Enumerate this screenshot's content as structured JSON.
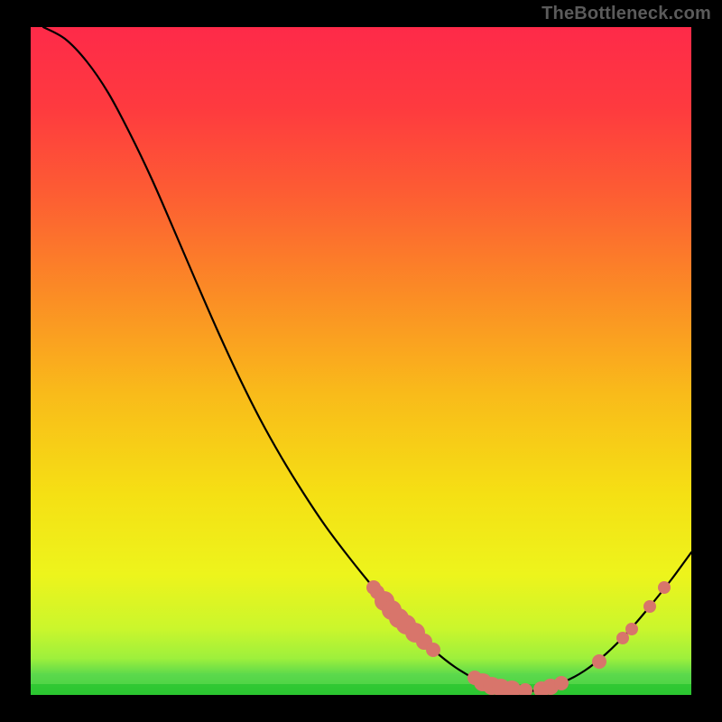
{
  "watermark": "TheBottleneck.com",
  "chart_data": {
    "type": "line",
    "title": "",
    "xlabel": "",
    "ylabel": "",
    "xlim": [
      34,
      766
    ],
    "ylim": [
      770,
      30
    ],
    "grid": false,
    "legend": false,
    "curve": {
      "name": "bottleneck-curve",
      "x": [
        48,
        72,
        96,
        120,
        144,
        168,
        192,
        216,
        240,
        264,
        288,
        312,
        336,
        360,
        384,
        408,
        432,
        456,
        480,
        504,
        528,
        552,
        576,
        600,
        624,
        648,
        672,
        696,
        720,
        744,
        766
      ],
      "y": [
        30,
        43,
        68,
        103,
        148,
        198,
        253,
        309,
        364,
        416,
        464,
        507,
        546,
        582,
        614,
        644,
        672,
        697,
        720,
        739,
        753,
        762,
        766,
        764,
        756,
        743,
        724,
        700,
        672,
        642,
        612
      ]
    },
    "markers": {
      "name": "highlight-dots",
      "color": "#d8756b",
      "points": [
        {
          "x": 414,
          "y": 651,
          "r": 8
        },
        {
          "x": 418,
          "y": 656,
          "r": 8
        },
        {
          "x": 426,
          "y": 666,
          "r": 11
        },
        {
          "x": 434,
          "y": 676,
          "r": 11
        },
        {
          "x": 442,
          "y": 685,
          "r": 11
        },
        {
          "x": 450,
          "y": 692,
          "r": 11
        },
        {
          "x": 460,
          "y": 701,
          "r": 11
        },
        {
          "x": 470,
          "y": 711,
          "r": 9
        },
        {
          "x": 480,
          "y": 720,
          "r": 8
        },
        {
          "x": 526,
          "y": 751,
          "r": 8
        },
        {
          "x": 535,
          "y": 756,
          "r": 10
        },
        {
          "x": 545,
          "y": 760,
          "r": 10
        },
        {
          "x": 555,
          "y": 762,
          "r": 10
        },
        {
          "x": 567,
          "y": 764,
          "r": 10
        },
        {
          "x": 582,
          "y": 765,
          "r": 8
        },
        {
          "x": 600,
          "y": 764,
          "r": 9
        },
        {
          "x": 610,
          "y": 761,
          "r": 9
        },
        {
          "x": 622,
          "y": 757,
          "r": 8
        },
        {
          "x": 664,
          "y": 733,
          "r": 8
        },
        {
          "x": 690,
          "y": 707,
          "r": 7
        },
        {
          "x": 700,
          "y": 697,
          "r": 7
        },
        {
          "x": 720,
          "y": 672,
          "r": 7
        },
        {
          "x": 736,
          "y": 651,
          "r": 7
        }
      ]
    },
    "bottom_band": {
      "color1": "#5bd94c",
      "color2": "#2bc530",
      "y_start": 746,
      "y_end": 770
    },
    "background_gradient": {
      "stops": [
        {
          "offset": 0.0,
          "color": "#fe2a49"
        },
        {
          "offset": 0.12,
          "color": "#fe3a3f"
        },
        {
          "offset": 0.25,
          "color": "#fd5d33"
        },
        {
          "offset": 0.4,
          "color": "#fb8c25"
        },
        {
          "offset": 0.55,
          "color": "#f9bb1a"
        },
        {
          "offset": 0.7,
          "color": "#f5e014"
        },
        {
          "offset": 0.82,
          "color": "#edf41c"
        },
        {
          "offset": 0.9,
          "color": "#cbf62c"
        },
        {
          "offset": 0.945,
          "color": "#9ef03c"
        },
        {
          "offset": 0.97,
          "color": "#5bd94c"
        },
        {
          "offset": 1.0,
          "color": "#2bc530"
        }
      ]
    }
  }
}
